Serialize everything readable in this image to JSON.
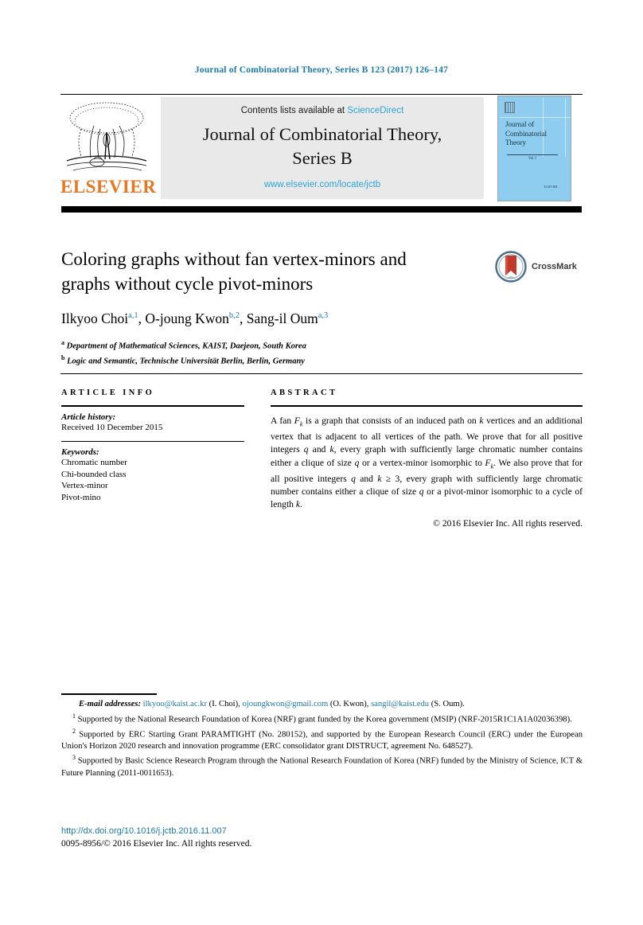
{
  "running_head": "Journal of Combinatorial Theory, Series B 123 (2017) 126–147",
  "masthead": {
    "contents_prefix": "Contents lists available at ",
    "sciencedirect": "ScienceDirect",
    "journal_title_line1": "Journal of Combinatorial Theory,",
    "journal_title_line2": "Series B",
    "journal_url": "www.elsevier.com/locate/jctb",
    "publisher": "ELSEVIER",
    "cover": {
      "title_line1": "Journal of",
      "title_line2": "Combinatorial",
      "title_line3": "Theory",
      "volume_text": "Vol 1",
      "footer_text": "ELSEVIER"
    }
  },
  "article": {
    "title_line1": "Coloring graphs without fan vertex-minors and",
    "title_line2": "graphs without cycle pivot-minors",
    "crossmark_label": "CrossMark",
    "authors": [
      {
        "name": "Ilkyoo Choi",
        "marks": "a,1"
      },
      {
        "name": "O-joung Kwon",
        "marks": "b,2"
      },
      {
        "name": "Sang-il Oum",
        "marks": "a,3"
      }
    ],
    "affiliations": [
      {
        "mark": "a",
        "text": "Department of Mathematical Sciences, KAIST, Daejeon, South Korea"
      },
      {
        "mark": "b",
        "text": "Logic and Semantic, Technische Universität Berlin, Berlin, Germany"
      }
    ]
  },
  "info": {
    "heading": "ARTICLE INFO",
    "history_label": "Article history:",
    "history_value": "Received 10 December 2015",
    "keywords_label": "Keywords:",
    "keywords": [
      "Chromatic number",
      "Chi-bounded class",
      "Vertex-minor",
      "Pivot-mino"
    ]
  },
  "abstract": {
    "heading": "ABSTRACT",
    "text_html": "A fan <i>F</i><span class=\"sub\">k</span> is a graph that consists of an induced path on <i>k</i> vertices and an additional vertex that is adjacent to all vertices of the path. We prove that for all positive integers <i>q</i> and <i>k</i>, every graph with sufficiently large chromatic number contains either a clique of size <i>q</i> or a vertex-minor isomorphic to <i>F</i><span class=\"sub\">k</span>. We also prove that for all positive integers <i>q</i> and <i>k</i> ≥ 3, every graph with sufficiently large chromatic number contains either a clique of size <i>q</i> or a pivot-minor isomorphic to a cycle of length <i>k</i>.",
    "copyright": "© 2016 Elsevier Inc. All rights reserved."
  },
  "footnotes": {
    "email_label": "E-mail addresses:",
    "emails": [
      {
        "address": "ilkyoo@kaist.ac.kr",
        "person": "(I. Choi)"
      },
      {
        "address": "ojoungkwon@gmail.com",
        "person": "(O. Kwon)"
      },
      {
        "address": "sangil@kaist.edu",
        "person": "(S. Oum)."
      }
    ],
    "notes": [
      {
        "mark": "1",
        "text": "Supported by the National Research Foundation of Korea (NRF) grant funded by the Korea government (MSIP) (NRF-2015R1C1A1A02036398)."
      },
      {
        "mark": "2",
        "text": "Supported by ERC Starting Grant PARAMTIGHT (No. 280152), and supported by the European Research Council (ERC) under the European Union's Horizon 2020 research and innovation programme (ERC consolidator grant DISTRUCT, agreement No. 648527)."
      },
      {
        "mark": "3",
        "text": "Supported by Basic Science Research Program through the National Research Foundation of Korea (NRF) funded by the Ministry of Science, ICT & Future Planning (2011-0011653)."
      }
    ]
  },
  "doi": "http://dx.doi.org/10.1016/j.jctb.2016.11.007",
  "issn_line": "0095-8956/© 2016 Elsevier Inc. All rights reserved.",
  "colors": {
    "link_blue": "#1a7aad",
    "sciencedirect_blue": "#2fa3d8",
    "elsevier_orange": "#e87722",
    "cover_blue": "#8ecdf0",
    "crossmark_red": "#c0392b",
    "crossmark_ring": "#4a6d8c"
  }
}
